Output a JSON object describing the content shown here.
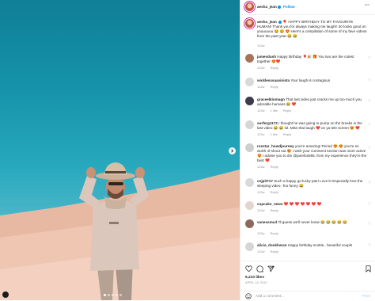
{
  "post": {
    "author": "aesha_jean",
    "follow_label": "Follow",
    "more_label": "···",
    "caption_user": "aesha_jean",
    "caption_text": "🎈 HAPPY BIRTHDAY TO MY FAVOURITE HUMAN! Thank you for always making me laugh!! 30 looks good on youuuuuu 😂 😂 😍 Here's a compilation of some of my fave videos from the past year 😂 😂",
    "caption_time": "122w",
    "likes": "6,210 likes",
    "date": "APRIL 14, 2021",
    "comment_placeholder": "Add a comment...",
    "post_label": "Post"
  },
  "comments": [
    {
      "user": "jamesdush",
      "text": "Happy birthday 🎈🎉 🎁 You two are the cutest together 😍❤️",
      "time": "122w",
      "likes": "",
      "reply": "Reply"
    },
    {
      "user": "wicklesssaasinista",
      "text": "Your laugh is contagious",
      "time": "122w",
      "likes": "",
      "reply": "Reply"
    },
    {
      "user": "graceelkinmagn",
      "text": "That last video just cracks me up too much you adorable humans 😂 ❤️",
      "time": "122w",
      "likes": "1 like",
      "reply": "Reply"
    },
    {
      "user": "surferg1172",
      "text": "I thought he was going to pump on the breaks in the last video 😂 😂 lol. Miss that laugh ❤️ on ya tele screen 😍 ❤️",
      "time": "122w",
      "likes": "1 like",
      "reply": "Reply"
    },
    {
      "user": "rosstar_howdjourney",
      "text": "you're amazing! Period 😍 😍 you're so worth of shout out 😍 I wish your comment section was more active 😍 I advise you to dm @janefox955, from my experience they're the best ❤️",
      "time": "122w",
      "likes": "",
      "reply": "Reply"
    },
    {
      "user": "cnjpit717",
      "text": "Such a happy go-lucky pair! Love it! Especially love the sleeping video. Too funny 😂",
      "time": "122w",
      "likes": "",
      "reply": "Reply"
    },
    {
      "user": "cupcake_news",
      "text": "❤️ ❤️ ❤️ ❤️ ❤️ ❤️ ❤️",
      "time": "122w",
      "likes": "",
      "reply": "Reply"
    },
    {
      "user": "vanessmcd",
      "text": "I'll guess we'll never know 😂 😂 😂 😂 😂",
      "time": "122w",
      "likes": "",
      "reply": "Reply"
    },
    {
      "user": "alicia_dookharan",
      "text": "Happy birthday scottie.. beautiful couple",
      "time": "122w",
      "likes": "",
      "reply": "Reply"
    }
  ],
  "colors": {
    "link_blue": "#0095f6",
    "sky": "#1592a9",
    "sand": "#ecbfa9",
    "muted": "#8e8e8e"
  },
  "icons": [
    "heart-icon",
    "comment-icon",
    "share-icon",
    "bookmark-icon",
    "smiley-icon",
    "chevron-right-icon",
    "user-tag-icon",
    "verified-badge-icon"
  ]
}
